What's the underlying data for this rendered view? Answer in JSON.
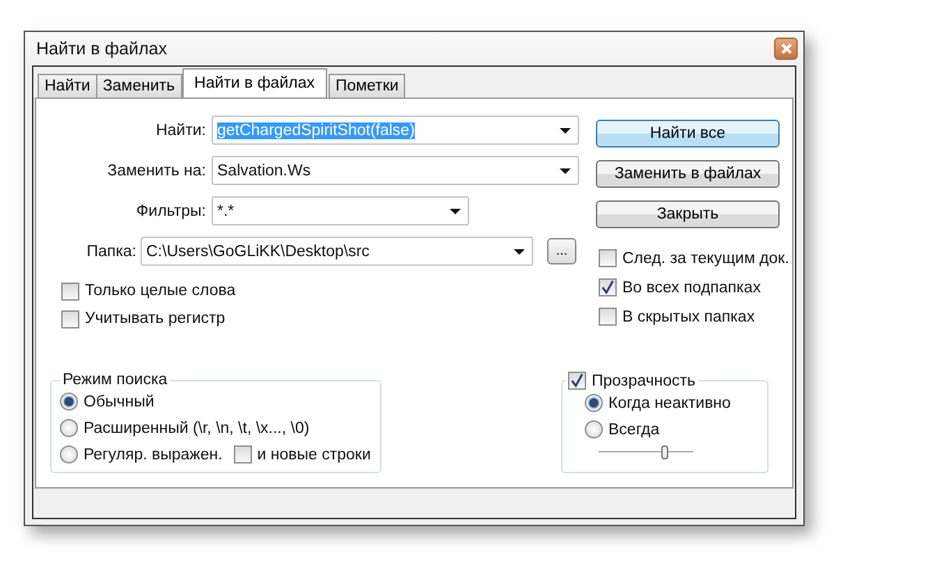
{
  "window": {
    "title": "Найти в файлах"
  },
  "tabs": [
    {
      "label": "Найти",
      "selected": false
    },
    {
      "label": "Заменить",
      "selected": false
    },
    {
      "label": "Найти в файлах",
      "selected": true
    },
    {
      "label": "Пометки",
      "selected": false
    }
  ],
  "fields": [
    {
      "label": "Найти:",
      "value": "getChargedSpiritShot(false)",
      "text_selected": true,
      "kind": "wide"
    },
    {
      "label": "Заменить на:",
      "value": "Salvation.Ws",
      "text_selected": false,
      "kind": "wide"
    },
    {
      "label": "Фильтры:",
      "value": "*.*",
      "text_selected": false,
      "kind": "narrow"
    }
  ],
  "folder": {
    "label": "Папка:",
    "value": "C:\\Users\\GoGLiKK\\Desktop\\src",
    "browse": "..."
  },
  "left_options": [
    {
      "label": "Только целые слова",
      "checked": false
    },
    {
      "label": "Учитывать регистр",
      "checked": false
    }
  ],
  "buttons": [
    {
      "label": "Найти все",
      "default": true
    },
    {
      "label": "Заменить в файлах",
      "default": false
    },
    {
      "label": "Закрыть",
      "default": false
    }
  ],
  "right_options": [
    {
      "label": "След. за текущим док.",
      "checked": false
    },
    {
      "label": "Во всех подпапках",
      "checked": true
    },
    {
      "label": "В скрытых папках",
      "checked": false
    }
  ],
  "search_mode": {
    "title": "Режим поиска",
    "options": [
      {
        "label": "Обычный",
        "selected": true
      },
      {
        "label": "Расширенный (\\r, \\n, \\t, \\x..., \\0)",
        "selected": false
      },
      {
        "label": "Регуляр. выражен.",
        "selected": false
      }
    ],
    "newlines": {
      "label": "и новые строки",
      "checked": false
    }
  },
  "transparency": {
    "label": "Прозрачность",
    "checked": true,
    "options": [
      {
        "label": "Когда неактивно",
        "selected": true
      },
      {
        "label": "Всегда",
        "selected": false
      }
    ],
    "slider": {
      "level": 0.7
    }
  }
}
